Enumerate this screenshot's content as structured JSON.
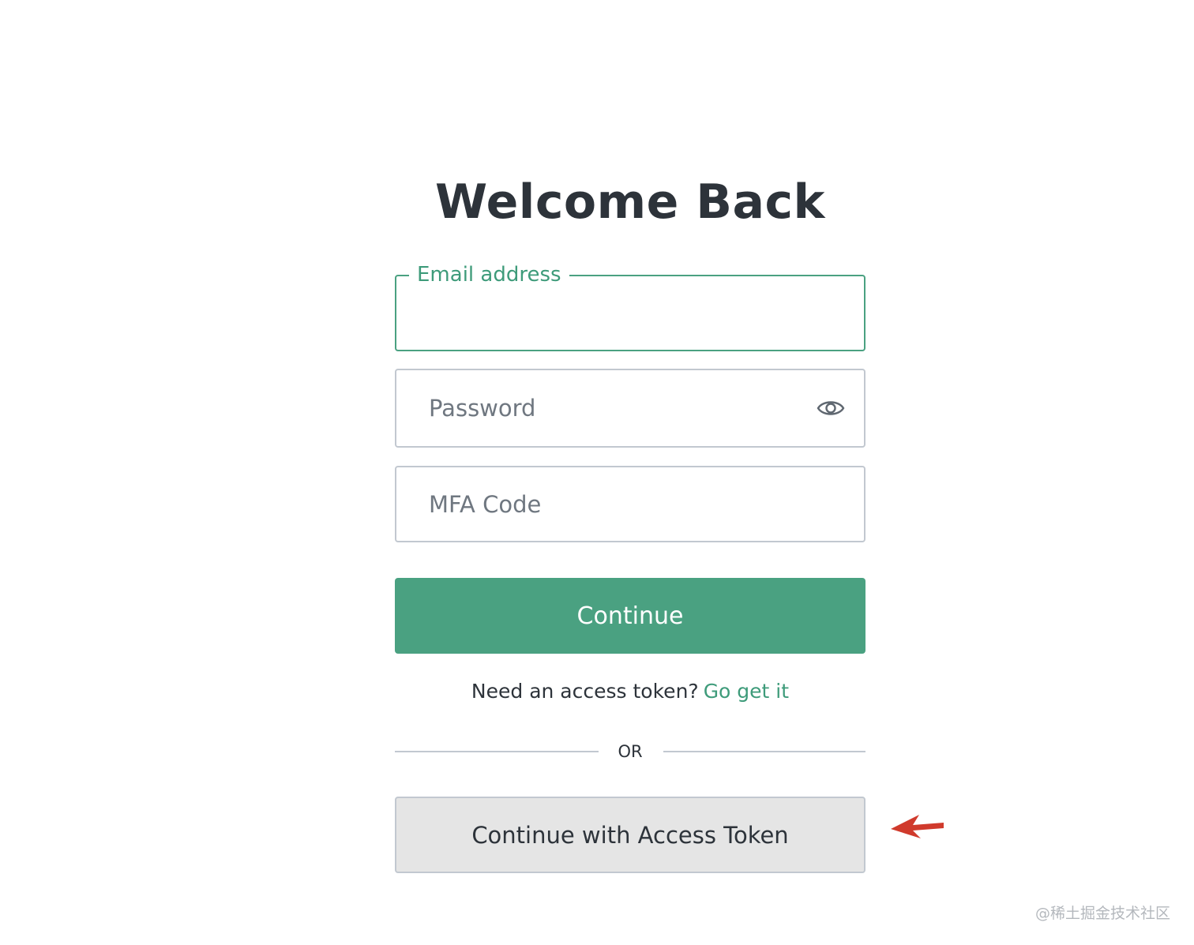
{
  "page": {
    "title": "Welcome Back"
  },
  "form": {
    "email": {
      "label": "Email address",
      "value": ""
    },
    "password": {
      "placeholder": "Password",
      "toggle_icon": "eye-icon"
    },
    "mfa": {
      "placeholder": "MFA Code"
    },
    "continue_label": "Continue",
    "token_prompt": "Need an access token?",
    "token_link": "Go get it",
    "divider_text": "OR",
    "token_button_label": "Continue with Access Token"
  },
  "annotation": {
    "arrow_icon": "red-arrow-left-icon",
    "arrow_color": "#d03a2c"
  },
  "watermark": {
    "text": "@稀土掘金技术社区"
  },
  "colors": {
    "accent": "#4aa181",
    "accent_text": "#3e9b7a",
    "heading": "#2d333a",
    "border": "#c2c8d0",
    "secondary_bg": "#e5e5e5"
  }
}
